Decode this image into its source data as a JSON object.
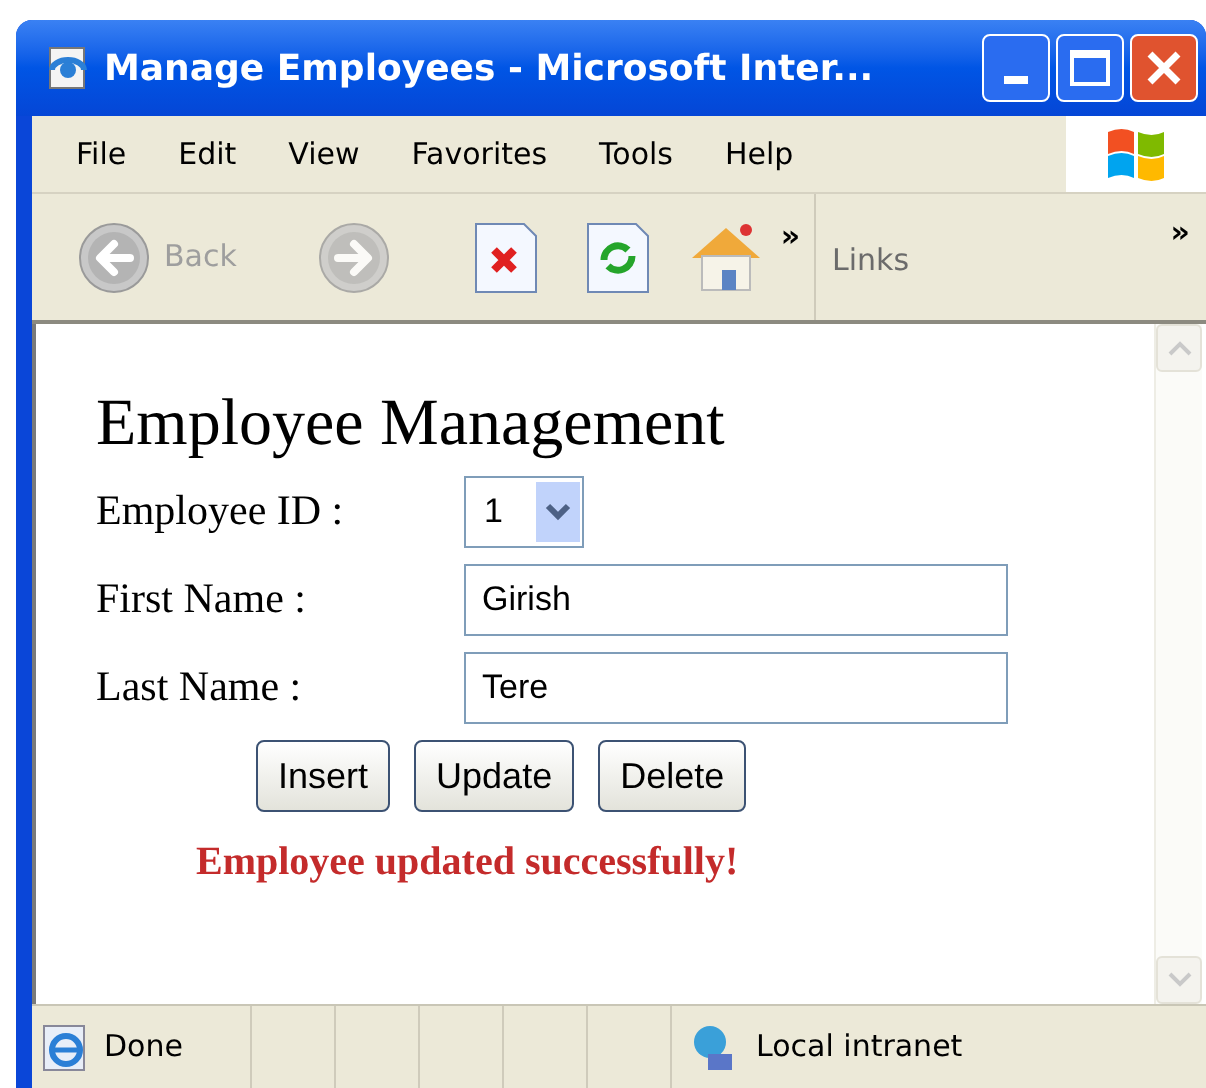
{
  "window": {
    "title": "Manage Employees - Microsoft Inter..."
  },
  "menu": [
    {
      "label": "File"
    },
    {
      "label": "Edit"
    },
    {
      "label": "View"
    },
    {
      "label": "Favorites"
    },
    {
      "label": "Tools"
    },
    {
      "label": "Help"
    }
  ],
  "toolbar": {
    "back": {
      "label": "Back",
      "disabled": true
    },
    "forward": {
      "disabled": true
    },
    "overflow": "»",
    "links_overflow": "»",
    "links": "Links"
  },
  "page": {
    "heading": "Employee Management",
    "fields": [
      {
        "kind": "select",
        "label": "Employee ID :",
        "value": "1"
      },
      {
        "kind": "text",
        "label": "First Name :",
        "value": "Girish"
      },
      {
        "kind": "text",
        "label": "Last Name :",
        "value": "Tere"
      }
    ],
    "buttons": [
      "Insert",
      "Update",
      "Delete"
    ],
    "message": "Employee updated successfully!"
  },
  "status_bar": {
    "status": "Done",
    "zone": "Local intranet"
  }
}
